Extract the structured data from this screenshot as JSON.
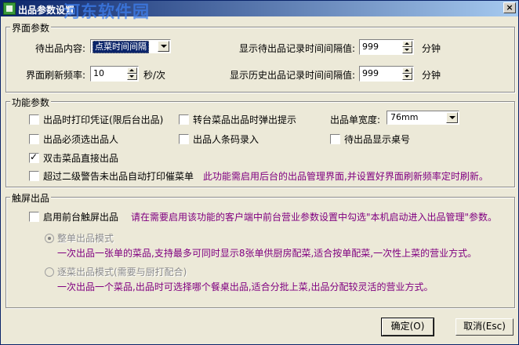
{
  "window": {
    "title": "出品参数设置",
    "watermark": "河东软件园",
    "close_label": "×"
  },
  "interface_group": {
    "legend": "界面参数",
    "pending_content_label": "待出品内容:",
    "pending_content_value": "点菜时间间隔",
    "refresh_label": "界面刷新频率:",
    "refresh_value": "10",
    "refresh_unit": "秒/次",
    "pending_interval_label": "显示待出品记录时间间隔值:",
    "pending_interval_value": "999",
    "pending_interval_unit": "分钟",
    "history_interval_label": "显示历史出品记录时间间隔值:",
    "history_interval_value": "999",
    "history_interval_unit": "分钟"
  },
  "function_group": {
    "legend": "功能参数",
    "checkboxes": [
      {
        "label": "出品时打印凭证(限后台出品)",
        "checked": false
      },
      {
        "label": "转台菜品出品时弹出提示",
        "checked": false
      },
      {
        "label": "出品必须选出品人",
        "checked": false
      },
      {
        "label": "出品人条码录入",
        "checked": false
      },
      {
        "label": "待出品显示桌号",
        "checked": false
      },
      {
        "label": "双击菜品直接出品",
        "checked": true
      },
      {
        "label": "超过二级警告未出品自动打印催菜单",
        "checked": false
      }
    ],
    "width_label": "出品单宽度:",
    "width_value": "76mm",
    "note": "此功能需启用后台的出品管理界面,并设置好界面刷新频率定时刷新。"
  },
  "touch_group": {
    "legend": "触屏出品",
    "enable_label": "启用前台触屏出品",
    "enable_note": "请在需要启用该功能的客户端中前台营业参数设置中勾选\"本机启动进入出品管理\"参数。",
    "mode1_label": "整单出品模式",
    "mode1_desc": "一次出品一张单的菜品,支持最多可同时显示8张单供厨房配菜,适合按单配菜,一次性上菜的营业方式。",
    "mode2_label": "逐菜出品模式(需要与厨打配合)",
    "mode2_desc": "一次出品一个菜品,出品时可选择哪个餐桌出品,适合分批上菜,出品分配较灵活的营业方式。"
  },
  "buttons": {
    "ok": "确定(O)",
    "cancel": "取消(Esc)"
  }
}
